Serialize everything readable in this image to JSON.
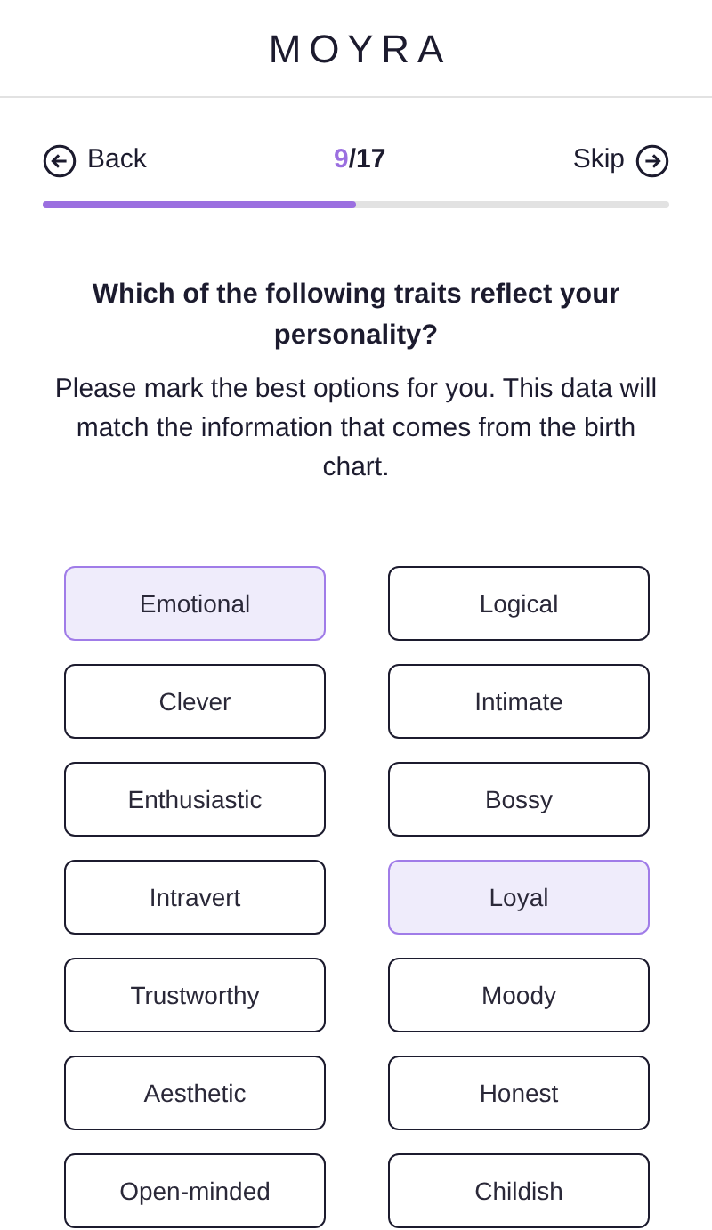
{
  "header": {
    "logo": "MOYRA"
  },
  "nav": {
    "back": "Back",
    "step_current": "9",
    "step_total": "/17",
    "skip": "Skip"
  },
  "progress": {
    "level": 0.5
  },
  "question": "Which of the following traits reflect your personality?",
  "instructions": "Please mark the best options for you. This data will match the information that comes from the birth chart.",
  "options": [
    {
      "label": "Emotional",
      "selected": true
    },
    {
      "label": "Logical",
      "selected": false
    },
    {
      "label": "Clever",
      "selected": false
    },
    {
      "label": "Intimate",
      "selected": false
    },
    {
      "label": "Enthusiastic",
      "selected": false
    },
    {
      "label": "Bossy",
      "selected": false
    },
    {
      "label": "Intravert",
      "selected": false
    },
    {
      "label": "Loyal",
      "selected": true
    },
    {
      "label": "Trustworthy",
      "selected": false
    },
    {
      "label": "Moody",
      "selected": false
    },
    {
      "label": "Aesthetic",
      "selected": false
    },
    {
      "label": "Honest",
      "selected": false
    },
    {
      "label": "Open-minded",
      "selected": false
    },
    {
      "label": "Childish",
      "selected": false
    }
  ]
}
